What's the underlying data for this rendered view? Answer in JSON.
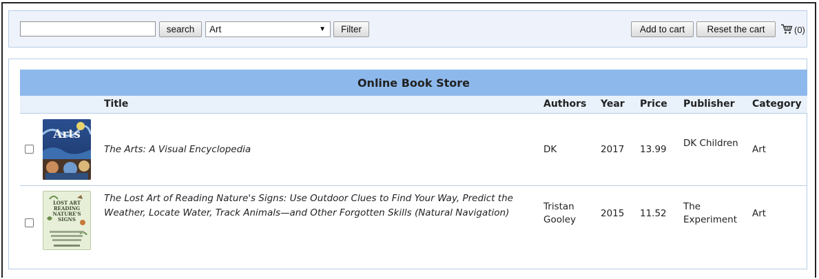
{
  "toolbar": {
    "search_value": "",
    "search_label": "search",
    "category_selected": "Art",
    "filter_label": "Filter",
    "add_to_cart_label": "Add to cart",
    "reset_cart_label": "Reset the cart",
    "cart_count": "(0)",
    "cart_icon": "shopping-cart-icon"
  },
  "store": {
    "title": "Online Book Store",
    "columns": [
      "Title",
      "Authors",
      "Year",
      "Price",
      "Publisher",
      "Category"
    ],
    "books": [
      {
        "title": "The Arts: A Visual Encyclopedia",
        "authors": "DK",
        "year": "2017",
        "price": "13.99",
        "publisher": "DK Children",
        "category": "Art",
        "cover_text": "Arts",
        "checked": false
      },
      {
        "title": "The Lost Art of Reading Nature's Signs: Use Outdoor Clues to Find Your Way, Predict the Weather, Locate Water, Track Animals—and Other Forgotten Skills (Natural Navigation)",
        "authors": "Tristan Gooley",
        "year": "2015",
        "price": "11.52",
        "publisher": "The Experiment",
        "category": "Art",
        "cover_text": "LOST ART READING NATURE'S SIGNS",
        "checked": false
      }
    ]
  },
  "colors": {
    "title_bar": "#8db8ec",
    "toolbar_bg": "#eef3fb",
    "border": "#b7cde4"
  }
}
